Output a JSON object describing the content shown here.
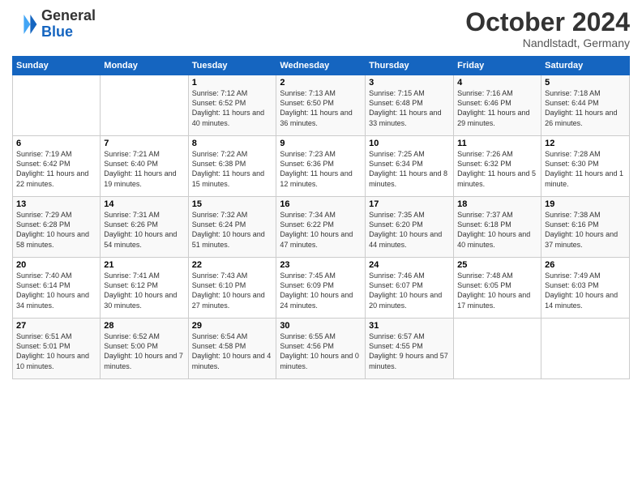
{
  "header": {
    "logo_general": "General",
    "logo_blue": "Blue",
    "month_title": "October 2024",
    "location": "Nandlstadt, Germany"
  },
  "days_of_week": [
    "Sunday",
    "Monday",
    "Tuesday",
    "Wednesday",
    "Thursday",
    "Friday",
    "Saturday"
  ],
  "weeks": [
    [
      {
        "day": "",
        "info": ""
      },
      {
        "day": "",
        "info": ""
      },
      {
        "day": "1",
        "info": "Sunrise: 7:12 AM\nSunset: 6:52 PM\nDaylight: 11 hours and 40 minutes."
      },
      {
        "day": "2",
        "info": "Sunrise: 7:13 AM\nSunset: 6:50 PM\nDaylight: 11 hours and 36 minutes."
      },
      {
        "day": "3",
        "info": "Sunrise: 7:15 AM\nSunset: 6:48 PM\nDaylight: 11 hours and 33 minutes."
      },
      {
        "day": "4",
        "info": "Sunrise: 7:16 AM\nSunset: 6:46 PM\nDaylight: 11 hours and 29 minutes."
      },
      {
        "day": "5",
        "info": "Sunrise: 7:18 AM\nSunset: 6:44 PM\nDaylight: 11 hours and 26 minutes."
      }
    ],
    [
      {
        "day": "6",
        "info": "Sunrise: 7:19 AM\nSunset: 6:42 PM\nDaylight: 11 hours and 22 minutes."
      },
      {
        "day": "7",
        "info": "Sunrise: 7:21 AM\nSunset: 6:40 PM\nDaylight: 11 hours and 19 minutes."
      },
      {
        "day": "8",
        "info": "Sunrise: 7:22 AM\nSunset: 6:38 PM\nDaylight: 11 hours and 15 minutes."
      },
      {
        "day": "9",
        "info": "Sunrise: 7:23 AM\nSunset: 6:36 PM\nDaylight: 11 hours and 12 minutes."
      },
      {
        "day": "10",
        "info": "Sunrise: 7:25 AM\nSunset: 6:34 PM\nDaylight: 11 hours and 8 minutes."
      },
      {
        "day": "11",
        "info": "Sunrise: 7:26 AM\nSunset: 6:32 PM\nDaylight: 11 hours and 5 minutes."
      },
      {
        "day": "12",
        "info": "Sunrise: 7:28 AM\nSunset: 6:30 PM\nDaylight: 11 hours and 1 minute."
      }
    ],
    [
      {
        "day": "13",
        "info": "Sunrise: 7:29 AM\nSunset: 6:28 PM\nDaylight: 10 hours and 58 minutes."
      },
      {
        "day": "14",
        "info": "Sunrise: 7:31 AM\nSunset: 6:26 PM\nDaylight: 10 hours and 54 minutes."
      },
      {
        "day": "15",
        "info": "Sunrise: 7:32 AM\nSunset: 6:24 PM\nDaylight: 10 hours and 51 minutes."
      },
      {
        "day": "16",
        "info": "Sunrise: 7:34 AM\nSunset: 6:22 PM\nDaylight: 10 hours and 47 minutes."
      },
      {
        "day": "17",
        "info": "Sunrise: 7:35 AM\nSunset: 6:20 PM\nDaylight: 10 hours and 44 minutes."
      },
      {
        "day": "18",
        "info": "Sunrise: 7:37 AM\nSunset: 6:18 PM\nDaylight: 10 hours and 40 minutes."
      },
      {
        "day": "19",
        "info": "Sunrise: 7:38 AM\nSunset: 6:16 PM\nDaylight: 10 hours and 37 minutes."
      }
    ],
    [
      {
        "day": "20",
        "info": "Sunrise: 7:40 AM\nSunset: 6:14 PM\nDaylight: 10 hours and 34 minutes."
      },
      {
        "day": "21",
        "info": "Sunrise: 7:41 AM\nSunset: 6:12 PM\nDaylight: 10 hours and 30 minutes."
      },
      {
        "day": "22",
        "info": "Sunrise: 7:43 AM\nSunset: 6:10 PM\nDaylight: 10 hours and 27 minutes."
      },
      {
        "day": "23",
        "info": "Sunrise: 7:45 AM\nSunset: 6:09 PM\nDaylight: 10 hours and 24 minutes."
      },
      {
        "day": "24",
        "info": "Sunrise: 7:46 AM\nSunset: 6:07 PM\nDaylight: 10 hours and 20 minutes."
      },
      {
        "day": "25",
        "info": "Sunrise: 7:48 AM\nSunset: 6:05 PM\nDaylight: 10 hours and 17 minutes."
      },
      {
        "day": "26",
        "info": "Sunrise: 7:49 AM\nSunset: 6:03 PM\nDaylight: 10 hours and 14 minutes."
      }
    ],
    [
      {
        "day": "27",
        "info": "Sunrise: 6:51 AM\nSunset: 5:01 PM\nDaylight: 10 hours and 10 minutes."
      },
      {
        "day": "28",
        "info": "Sunrise: 6:52 AM\nSunset: 5:00 PM\nDaylight: 10 hours and 7 minutes."
      },
      {
        "day": "29",
        "info": "Sunrise: 6:54 AM\nSunset: 4:58 PM\nDaylight: 10 hours and 4 minutes."
      },
      {
        "day": "30",
        "info": "Sunrise: 6:55 AM\nSunset: 4:56 PM\nDaylight: 10 hours and 0 minutes."
      },
      {
        "day": "31",
        "info": "Sunrise: 6:57 AM\nSunset: 4:55 PM\nDaylight: 9 hours and 57 minutes."
      },
      {
        "day": "",
        "info": ""
      },
      {
        "day": "",
        "info": ""
      }
    ]
  ]
}
